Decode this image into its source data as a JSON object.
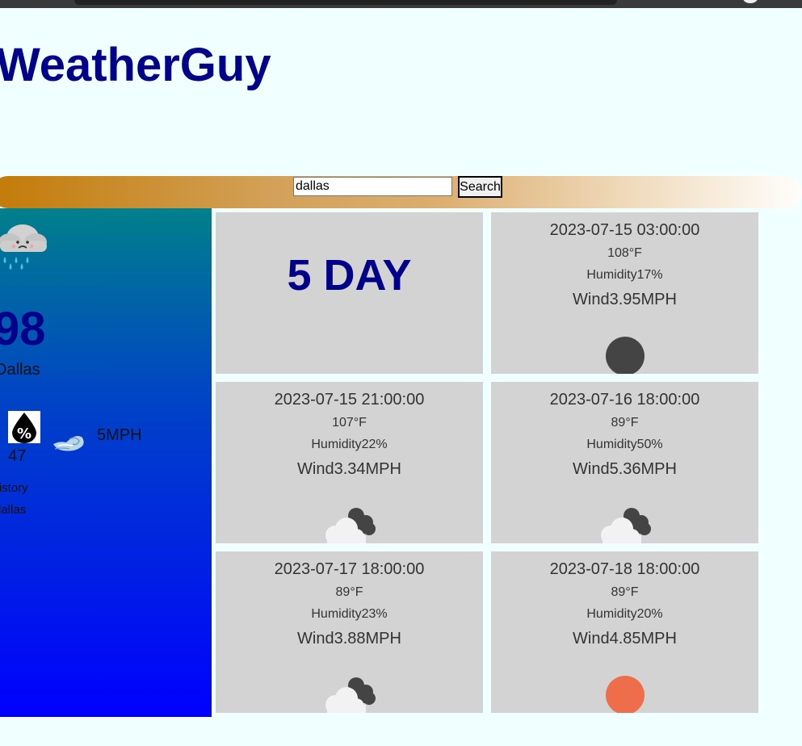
{
  "app": {
    "title": "WeatherGuy"
  },
  "search": {
    "value": "dallas",
    "button_label": "Search"
  },
  "current": {
    "icon": "rain-cloud-icon",
    "temp": "98",
    "city": "Dallas",
    "humidity_icon": "humidity-percent-icon",
    "humidity": "47",
    "wind_icon": "wind-icon",
    "wind": "5MPH",
    "history_label": "History",
    "history_items": [
      "dallas"
    ]
  },
  "forecast": {
    "title": "5 DAY",
    "days": [
      {
        "date": "2023-07-15 03:00:00",
        "temp": "108°F",
        "humidity": "Humidity17%",
        "wind": "Wind3.95MPH",
        "icon": "moon-icon"
      },
      {
        "date": "2023-07-15 21:00:00",
        "temp": "107°F",
        "humidity": "Humidity22%",
        "wind": "Wind3.34MPH",
        "icon": "cloudy-icon"
      },
      {
        "date": "2023-07-16 18:00:00",
        "temp": "89°F",
        "humidity": "Humidity50%",
        "wind": "Wind5.36MPH",
        "icon": "cloudy-icon"
      },
      {
        "date": "2023-07-17 18:00:00",
        "temp": "89°F",
        "humidity": "Humidity23%",
        "wind": "Wind3.88MPH",
        "icon": "cloudy-icon"
      },
      {
        "date": "2023-07-18 18:00:00",
        "temp": "89°F",
        "humidity": "Humidity20%",
        "wind": "Wind4.85MPH",
        "icon": "sun-icon"
      }
    ]
  },
  "colors": {
    "title": "#00008b",
    "page_background": "#f0ffff",
    "card_background": "#d3d3d3",
    "moon": "#444444",
    "sun": "#ee6e4c"
  }
}
